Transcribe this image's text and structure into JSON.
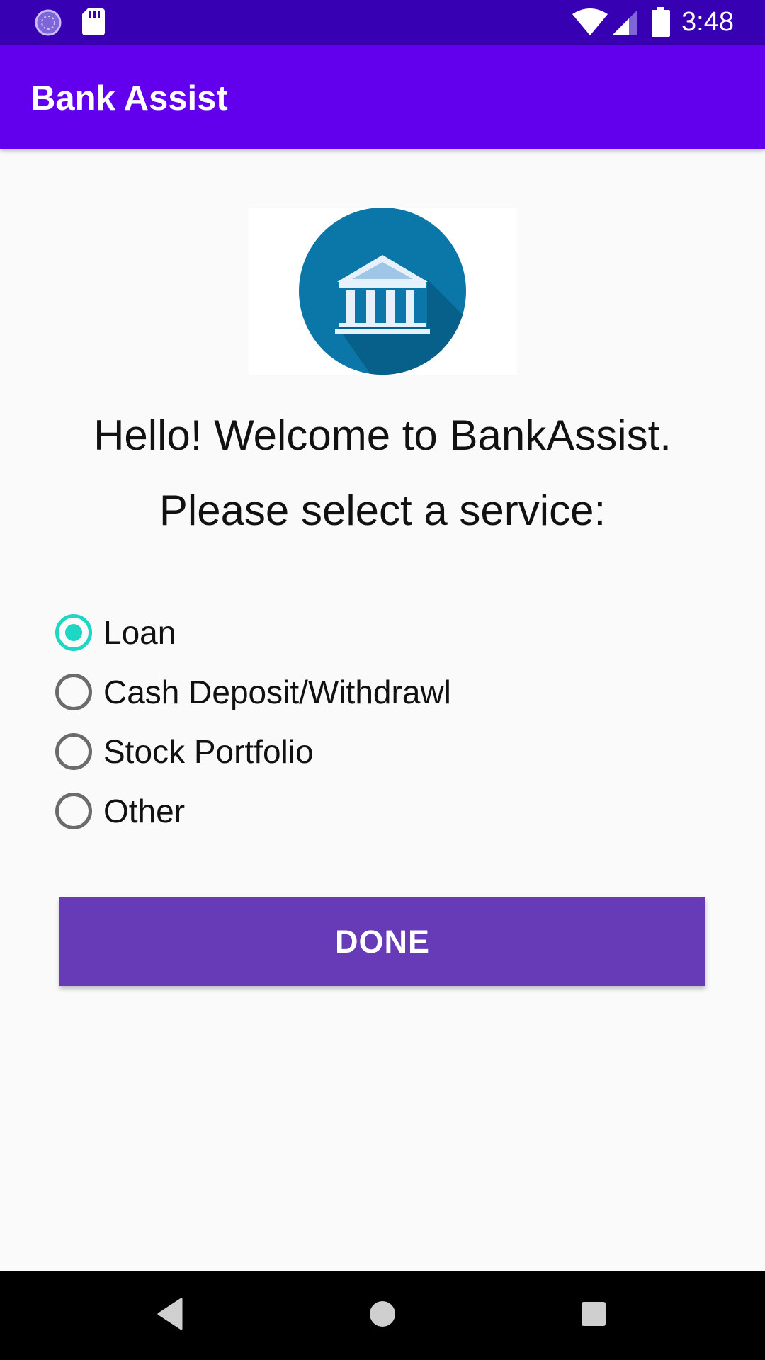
{
  "status_bar": {
    "time": "3:48",
    "icons": [
      "loading-icon",
      "sd-card-icon",
      "wifi-icon",
      "signal-icon",
      "battery-icon"
    ]
  },
  "app_bar": {
    "title": "Bank Assist"
  },
  "logo": {
    "icon": "bank-building-icon",
    "colors": {
      "circle": "#0b77a8",
      "shadow": "#07608a",
      "building": "#e8f1fb"
    }
  },
  "main": {
    "welcome_text": "Hello! Welcome to BankAssist.",
    "prompt_text": "Please select a service:",
    "services": [
      {
        "label": "Loan",
        "selected": true
      },
      {
        "label": "Cash Deposit/Withdrawl",
        "selected": false
      },
      {
        "label": "Stock Portfolio",
        "selected": false
      },
      {
        "label": "Other",
        "selected": false
      }
    ],
    "done_label": "DONE"
  },
  "nav_bar": {
    "icons": [
      "back-icon",
      "home-icon",
      "recents-icon"
    ]
  },
  "colors": {
    "status_bar": "#3700b3",
    "app_bar": "#6200ee",
    "radio_accent": "#1dd6c3",
    "button": "#673ab7"
  }
}
